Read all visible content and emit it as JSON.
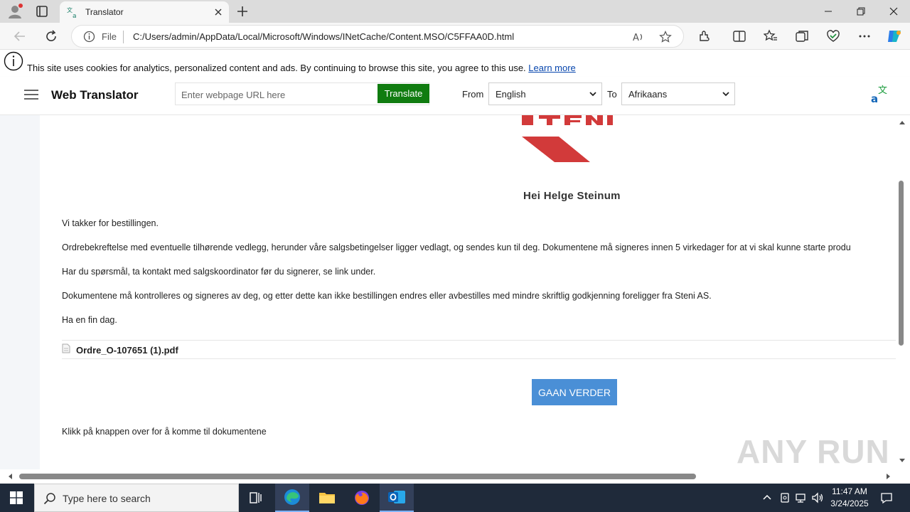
{
  "browser": {
    "tab_title": "Translator",
    "address_prefix": "File",
    "url": "C:/Users/admin/AppData/Local/Microsoft/Windows/INetCache/Content.MSO/C5FFAA0D.html"
  },
  "cookie_notice": {
    "text": "This site uses cookies for analytics, personalized content and ads. By continuing to browse this site, you agree to this use.",
    "link": "Learn more"
  },
  "translator": {
    "brand": "Web Translator",
    "url_placeholder": "Enter webpage URL here",
    "translate_label": "Translate",
    "from_label": "From",
    "from_value": "English",
    "to_label": "To",
    "to_value": "Afrikaans"
  },
  "email": {
    "greeting": "Hei Helge Steinum",
    "paragraphs": [
      "Vi takker for bestillingen.",
      "Ordrebekreftelse med eventuelle tilhørende vedlegg, herunder våre salgsbetingelser ligger vedlagt, og sendes kun til deg. Dokumentene må signeres innen 5 virkedager for at vi skal kunne starte produ",
      "Har du spørsmål, ta kontakt med salgskoordinator før du signerer, se link under.",
      "Dokumentene må kontrolleres og signeres av deg, og etter dette kan ikke bestillingen endres eller avbestilles med mindre skriftlig godkjenning foreligger fra Steni AS.",
      "Ha en fin dag."
    ],
    "attachment": "Ordre_O-107651 (1).pdf",
    "button": "GAAN VERDER",
    "footer": "Klikk på knappen over for å komme til dokumentene"
  },
  "watermark": "ANY RUN",
  "taskbar": {
    "search_placeholder": "Type here to search",
    "time": "11:47 AM",
    "date": "3/24/2025"
  },
  "colors": {
    "translate_button": "#107c10",
    "go_button": "#4a8fd6",
    "logo_red": "#d23a3a",
    "taskbar": "#1f2a3a"
  }
}
